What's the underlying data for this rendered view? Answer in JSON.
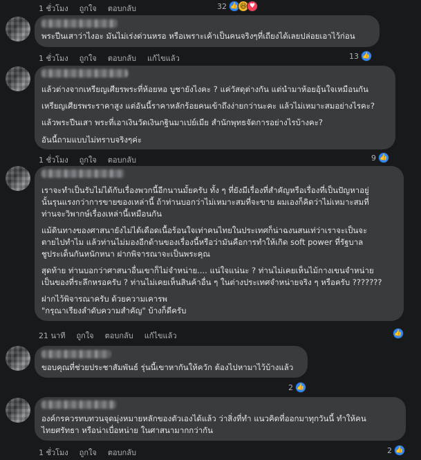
{
  "comments": [
    {
      "lines": [],
      "meta": {
        "time": "1 ชั่วโมง",
        "like": "ถูกใจ",
        "reply": "ตอบกลับ"
      },
      "reactions": {
        "count": "32"
      }
    },
    {
      "lines": [
        "พระปีนเสาว่าไงอะ มันไม่เร่งด่วนหรอ หรือเพราะเค้าเป็นคนจริงๆที่เถียงได้เลยปล่อยเอาไว้ก่อน"
      ],
      "meta": {
        "time": "1 ชั่วโมง",
        "like": "ถูกใจ",
        "reply": "ตอบกลับ",
        "edited": "แก้ไขแล้ว"
      },
      "reactions": {
        "count": "13"
      }
    },
    {
      "lines": [
        "แล้วต่างจากเหรียญเศียรพระที่ห้อยหอ บูชายังไงคะ ? แค่วัสดุต่างกัน แต่นำมาห้อยอุ้นใจเหมือนกัน",
        "เหรียญเศียรพระราคาสูง แต่อันนี้ราคาหลักร้อยคนเข้าถึงง่ายกว่านะคะ แล้วไม่เหมาะสมอย่างไรคะ?",
        "แล้วพระปีนเสา พระที่เอาเงินวัดเงินกฐินมาเปย์เมีย สำนักพุทธจัดการอย่างไรบ้างคะ?",
        "อันนี้ถามแบบไม่ทราบจริงๆค่ะ"
      ],
      "meta": {
        "time": "1 ชั่วโมง",
        "like": "ถูกใจ",
        "reply": "ตอบกลับ"
      },
      "reactions": {
        "count": "9"
      }
    },
    {
      "lines": [
        "เราจะทำเป็นรับไม่ได้กับเรื่องพวกนี้อีกนานมั้ยครับ ทั้ง ๆ ที่ยังมีเรื่องที่สำคัญหรือเรื่องที่เป็นปัญหาอยู่",
        "นั้นรุนแรงกว่าการขายของเหล่านี้ ถ้าท่านบอกว่าไม่เหมาะสมที่จะขาย ผมเองก็คิดว่าไม่เหมาะสมที่",
        "ท่านจะวิพากษ์เรื่องเหล่านี้เหมือนกัน",
        "แม้ดินทางของศาสนายังไม่ได้เดือดเนื้อร้อนใจเท่าคนไทยในประเทศก็น่าฉงนสนเท่ว่าเราจะเป็นจะ",
        "ตายไปทำไม แล้วท่านไม่มองอีกด้านของเรื่องนี้หรือว่ามันคือการทำให้เกิด soft power ที่รัฐบาล",
        "ชูประเด็นกันหนักหนา ฝากพิจารณาจะเป็นพระคุณ",
        "สุดท้าย ท่านบอกว่าศาสนาอื่นเขาก็ไม่จำหน่าย.... แน่ใจแน่นะ ? ท่านไม่เคยเห็นไม้กางเขนจำหน่าย",
        "เป็นของที่ระลึกหรอครับ ? ท่านไม่เคยเห็นสินค้าอื่น ๆ ในต่างประเทศจำหน่ายจริง ๆ หรือครับ ???????",
        "ฝากไว้พิจารณาครับ ด้วยความเคารพ",
        "\"กรุณาเรียงลำดับความสำคัญ\" บ้างก็ดีครับ"
      ],
      "meta": {
        "time": "21 นาที",
        "like": "ถูกใจ",
        "reply": "ตอบกลับ",
        "edited": "แก้ไขแล้ว"
      },
      "reactions": {
        "count": ""
      }
    },
    {
      "lines": [
        "ขอบคุณที่ช่วยประชาสัมพันธ์ รุ่นนี้เขาหากันให้ควัก ต้องไปหามาไว้บ้างแล้ว"
      ],
      "meta": {
        "time": "",
        "like": "",
        "reply": ""
      },
      "reactions": {
        "count": "2"
      }
    },
    {
      "lines": [
        "องค์กรควรทบทวนจุดมุ่งหมายหลักของตัวเองได้แล้ว ว่าสิ่งที่ทำ แนวคิดที่ออกมาทุกวันนี้ ทำให้คน",
        "ไทยศรัทธา หรือน่าเบื่อหน่าย ในศาสนามากกว่ากัน"
      ],
      "meta": {
        "time": "1 ชั่วโมง",
        "like": "ถูกใจ",
        "reply": "ตอบกลับ"
      },
      "reactions": {
        "count": "2"
      }
    }
  ]
}
